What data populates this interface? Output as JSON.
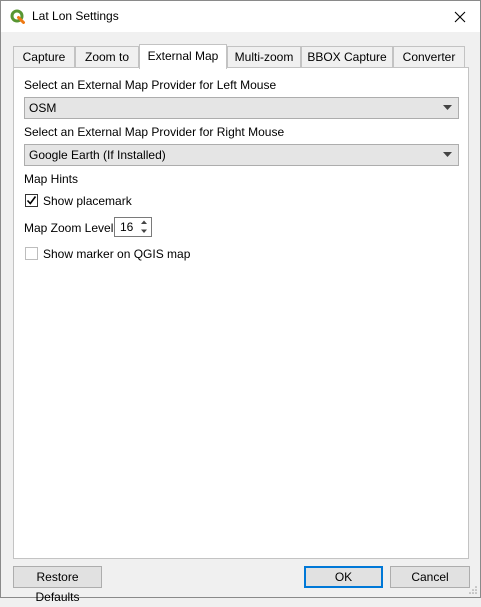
{
  "window": {
    "title": "Lat Lon Settings"
  },
  "tabs": [
    {
      "label": "Capture"
    },
    {
      "label": "Zoom to"
    },
    {
      "label": "External Map"
    },
    {
      "label": "Multi-zoom"
    },
    {
      "label": "BBOX Capture"
    },
    {
      "label": "Converter"
    }
  ],
  "active_tab": "External Map",
  "external_map": {
    "left_label": "Select an External Map Provider for Left Mouse",
    "left_value": "OSM",
    "right_label": "Select an External Map Provider for Right Mouse",
    "right_value": "Google Earth (If Installed)",
    "hints_label": "Map Hints",
    "show_placemark": {
      "label": "Show placemark",
      "checked": true
    },
    "zoom_label": "Map Zoom Level:",
    "zoom_value": "16",
    "show_marker": {
      "label": "Show marker on QGIS map",
      "checked": false
    }
  },
  "buttons": {
    "restore": "Restore Defaults",
    "ok": "OK",
    "cancel": "Cancel"
  },
  "colors": {
    "accent": "#0078d7",
    "qgis_green": "#589632"
  },
  "icons": {
    "app": "qgis-icon",
    "close": "close-icon",
    "dropdown": "chevron-down-icon",
    "check": "checkmark-icon",
    "spin_up": "spin-up-icon",
    "spin_down": "spin-down-icon"
  }
}
